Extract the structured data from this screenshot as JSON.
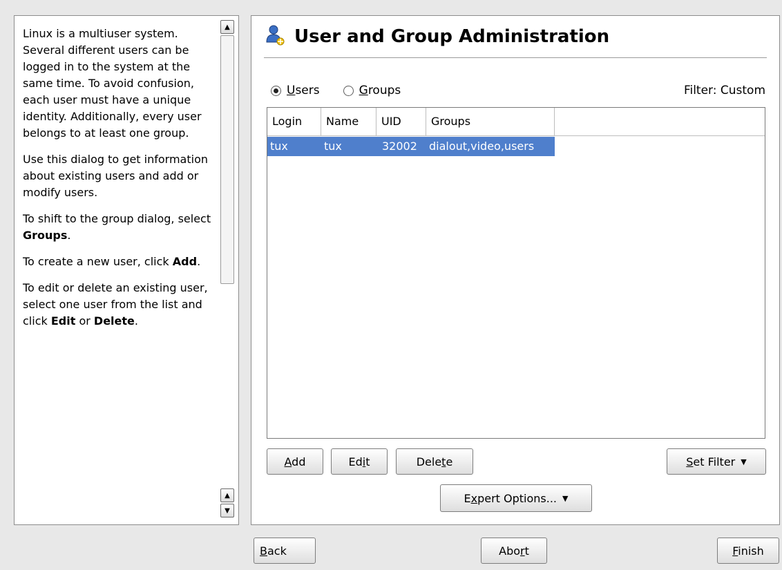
{
  "help": {
    "p1": "Linux is a multiuser system. Several different users can be logged in to the system at the same time. To avoid confusion, each user must have a unique identity. Additionally, every user belongs to at least one group.",
    "p2": "Use this dialog to get information about existing users and add or modify users.",
    "p3_prefix": "To shift to the group dialog, select ",
    "p3_bold": "Groups",
    "p3_suffix": ".",
    "p4_prefix": "To create a new user, click ",
    "p4_bold": "Add",
    "p4_suffix": ".",
    "p5_prefix": "To edit or delete an existing user, select one user from the list and click ",
    "p5_bold1": "Edit",
    "p5_mid": " or ",
    "p5_bold2": "Delete",
    "p5_suffix": "."
  },
  "main": {
    "title": "User and Group Administration",
    "radio_users_ul": "U",
    "radio_users_rest": "sers",
    "radio_groups_ul": "G",
    "radio_groups_rest": "roups",
    "selected_radio": "users",
    "filter_label": "Filter: Custom"
  },
  "table": {
    "columns": [
      "Login",
      "Name",
      "UID",
      "Groups"
    ],
    "rows": [
      [
        "tux",
        "tux",
        "32002",
        "dialout,video,users"
      ]
    ]
  },
  "buttons": {
    "add_ul": "A",
    "add_rest": "dd",
    "edit_pre": "Ed",
    "edit_ul": "i",
    "edit_post": "t",
    "delete_pre": "Dele",
    "delete_ul": "t",
    "delete_post": "e",
    "set_filter_ul": "S",
    "set_filter_rest": "et Filter",
    "expert_pre": "E",
    "expert_ul": "x",
    "expert_post": "pert Options...",
    "back_ul": "B",
    "back_rest": "ack",
    "abort_pre": "Abo",
    "abort_ul": "r",
    "abort_post": "t",
    "finish_ul": "F",
    "finish_rest": "inish"
  },
  "colors": {
    "selection": "#4f7fcc",
    "background": "#e8e8e8"
  }
}
